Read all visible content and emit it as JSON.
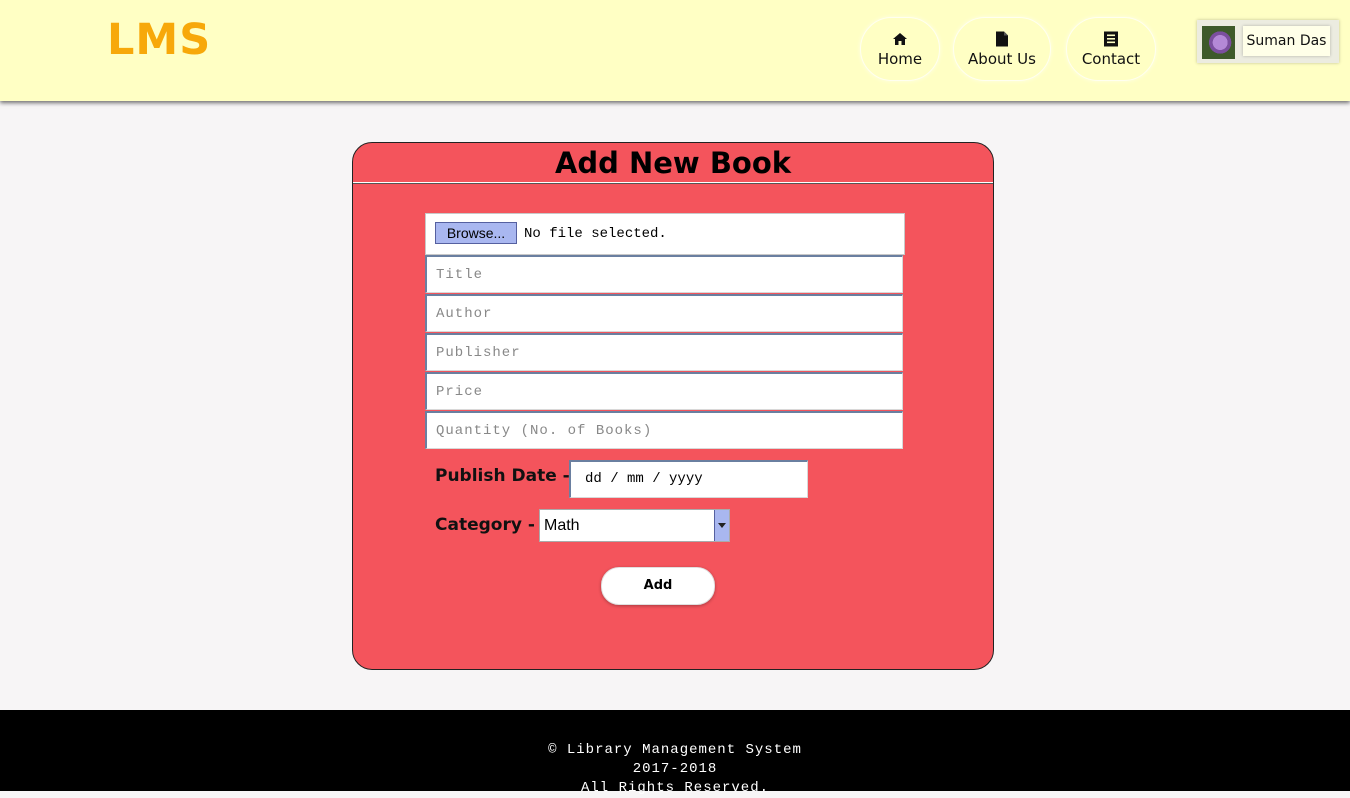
{
  "header": {
    "logo": "LMS",
    "nav": [
      {
        "label": "Home",
        "icon": "home-icon"
      },
      {
        "label": "About Us",
        "icon": "file-icon"
      },
      {
        "label": "Contact",
        "icon": "contact-list-icon"
      }
    ],
    "user": {
      "name": "Suman Das",
      "avatar": "user-avatar"
    }
  },
  "form": {
    "title": "Add New Book",
    "file": {
      "button_label": "Browse...",
      "status": "No file selected."
    },
    "fields": {
      "title_placeholder": "Title",
      "author_placeholder": "Author",
      "publisher_placeholder": "Publisher",
      "price_placeholder": "Price",
      "quantity_placeholder": "Quantity (No. of Books)"
    },
    "publish_date": {
      "label": "Publish Date -",
      "placeholder": "dd / mm / yyyy"
    },
    "category": {
      "label": "Category -",
      "selected": "Math"
    },
    "submit_label": "Add"
  },
  "footer": {
    "line1": "© Library Management System",
    "line2": "2017-2018",
    "line3": "All Rights Reserved."
  },
  "colors": {
    "header_bg": "#ffffc4",
    "logo": "#f7a80a",
    "card_bg": "#f4545c",
    "footer_bg": "#000000"
  }
}
